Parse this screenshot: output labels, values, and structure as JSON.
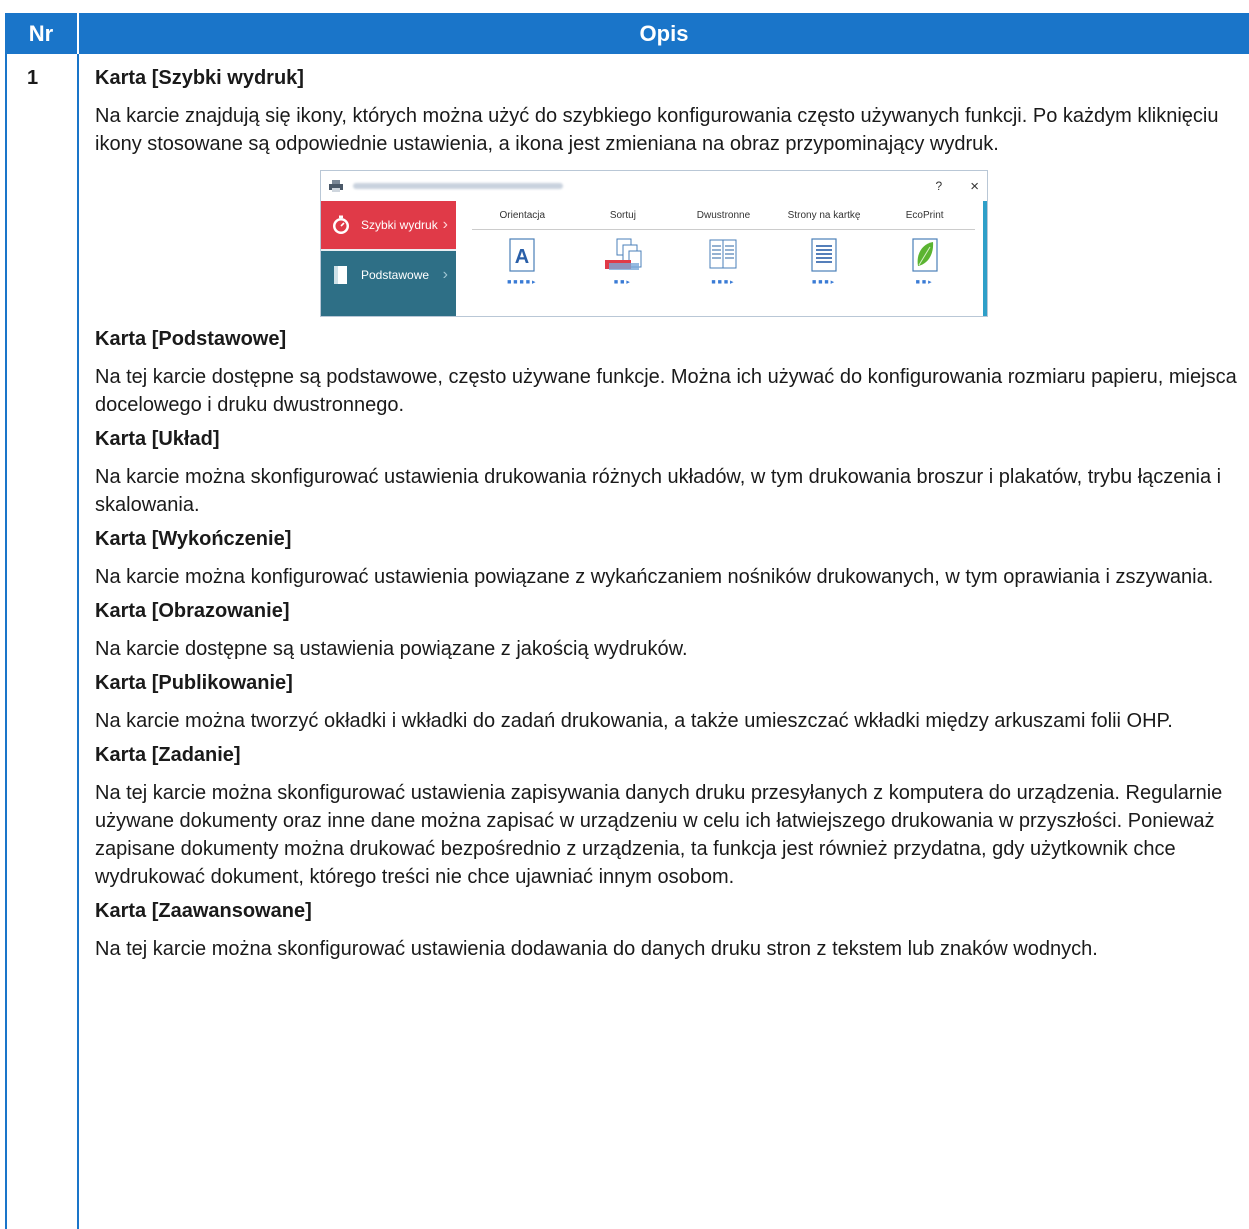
{
  "table": {
    "col_nr": "Nr",
    "col_desc": "Opis",
    "row_nr": "1"
  },
  "intro": {
    "title": "Karta [Szybki wydruk]",
    "text": "Na karcie znajdują się ikony, których można użyć do szybkiego konfigurowania często używanych funkcji. Po każdym kliknięciu ikony stosowane są odpowiednie ustawienia, a ikona jest zmieniana na obraz przypominający wydruk."
  },
  "screenshot": {
    "help": "?",
    "close": "×",
    "sidebar": [
      "Szybki wydruk",
      "Podstawowe"
    ],
    "features": [
      "Orientacja",
      "Sortuj",
      "Dwustronne",
      "Strony na kartkę",
      "EcoPrint"
    ],
    "icons": [
      "orientation-icon",
      "collate-icon",
      "duplex-icon",
      "pages-per-sheet-icon",
      "ecoprint-leaf-icon"
    ],
    "colors": {
      "active": "#e03a48",
      "sidebar": "#2e6f86",
      "header": "#1a75c9"
    }
  },
  "sections": [
    {
      "title": "Karta [Podstawowe]",
      "text": "Na tej karcie dostępne są podstawowe, często używane funkcje. Można ich używać do konfigurowania rozmiaru papieru, miejsca docelowego i druku dwustronnego."
    },
    {
      "title": "Karta [Układ]",
      "text": "Na karcie można skonfigurować ustawienia drukowania różnych układów, w tym drukowania broszur i plakatów, trybu łączenia i skalowania."
    },
    {
      "title": "Karta [Wykończenie]",
      "text": "Na karcie można konfigurować ustawienia powiązane z wykańczaniem nośników drukowanych, w tym oprawiania i zszywania."
    },
    {
      "title": "Karta [Obrazowanie]",
      "text": "Na karcie dostępne są ustawienia powiązane z jakością wydruków."
    },
    {
      "title": "Karta [Publikowanie]",
      "text": "Na karcie można tworzyć okładki i wkładki do zadań drukowania, a także umieszczać wkładki między arkuszami folii OHP."
    },
    {
      "title": "Karta [Zadanie]",
      "text": "Na tej karcie można skonfigurować ustawienia zapisywania danych druku przesyłanych z komputera do urządzenia. Regularnie używane dokumenty oraz inne dane można zapisać w urządzeniu w celu ich łatwiejszego drukowania w przyszłości. Ponieważ zapisane dokumenty można drukować bezpośrednio z urządzenia, ta funkcja jest również przydatna, gdy użytkownik chce wydrukować dokument, którego treści nie chce ujawniać innym osobom."
    },
    {
      "title": "Karta [Zaawansowane]",
      "text": "Na tej karcie można skonfigurować ustawienia dodawania do danych druku stron z tekstem lub znaków wodnych."
    }
  ]
}
